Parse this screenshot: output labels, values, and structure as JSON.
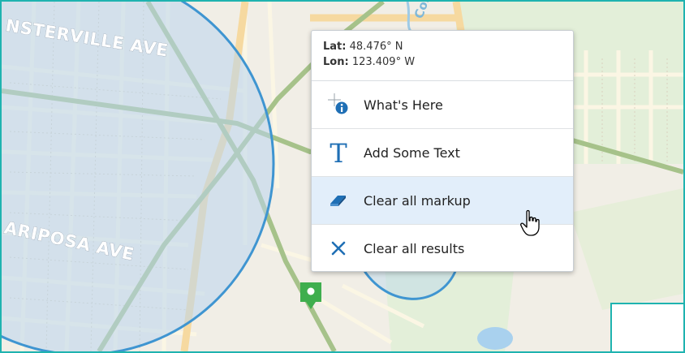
{
  "map": {
    "streets": [
      "NSTERVILLE AVE",
      "ARIPOSA AVE"
    ],
    "faded_label": "Cor",
    "colors": {
      "land": "#f1eee6",
      "residential": "#dfe2cf",
      "park": "#e3efd9",
      "road_minor": "#fbf6e4",
      "road_major": "#f6d9a0",
      "road_arterial": "#a6c28a",
      "buffer_fill": "#b9d6ee",
      "buffer_stroke": "#3f95d1",
      "marker": "#3fae4e",
      "accent": "#1fb3b0"
    }
  },
  "context_menu": {
    "lat_label": "Lat:",
    "lat_value": "48.476° N",
    "lon_label": "Lon:",
    "lon_value": "123.409° W",
    "items": [
      {
        "label": "What's Here",
        "icon": "whats-here-icon"
      },
      {
        "label": "Add Some Text",
        "icon": "text-icon"
      },
      {
        "label": "Clear all markup",
        "icon": "eraser-icon",
        "hovered": true
      },
      {
        "label": "Clear all results",
        "icon": "close-icon"
      }
    ]
  }
}
